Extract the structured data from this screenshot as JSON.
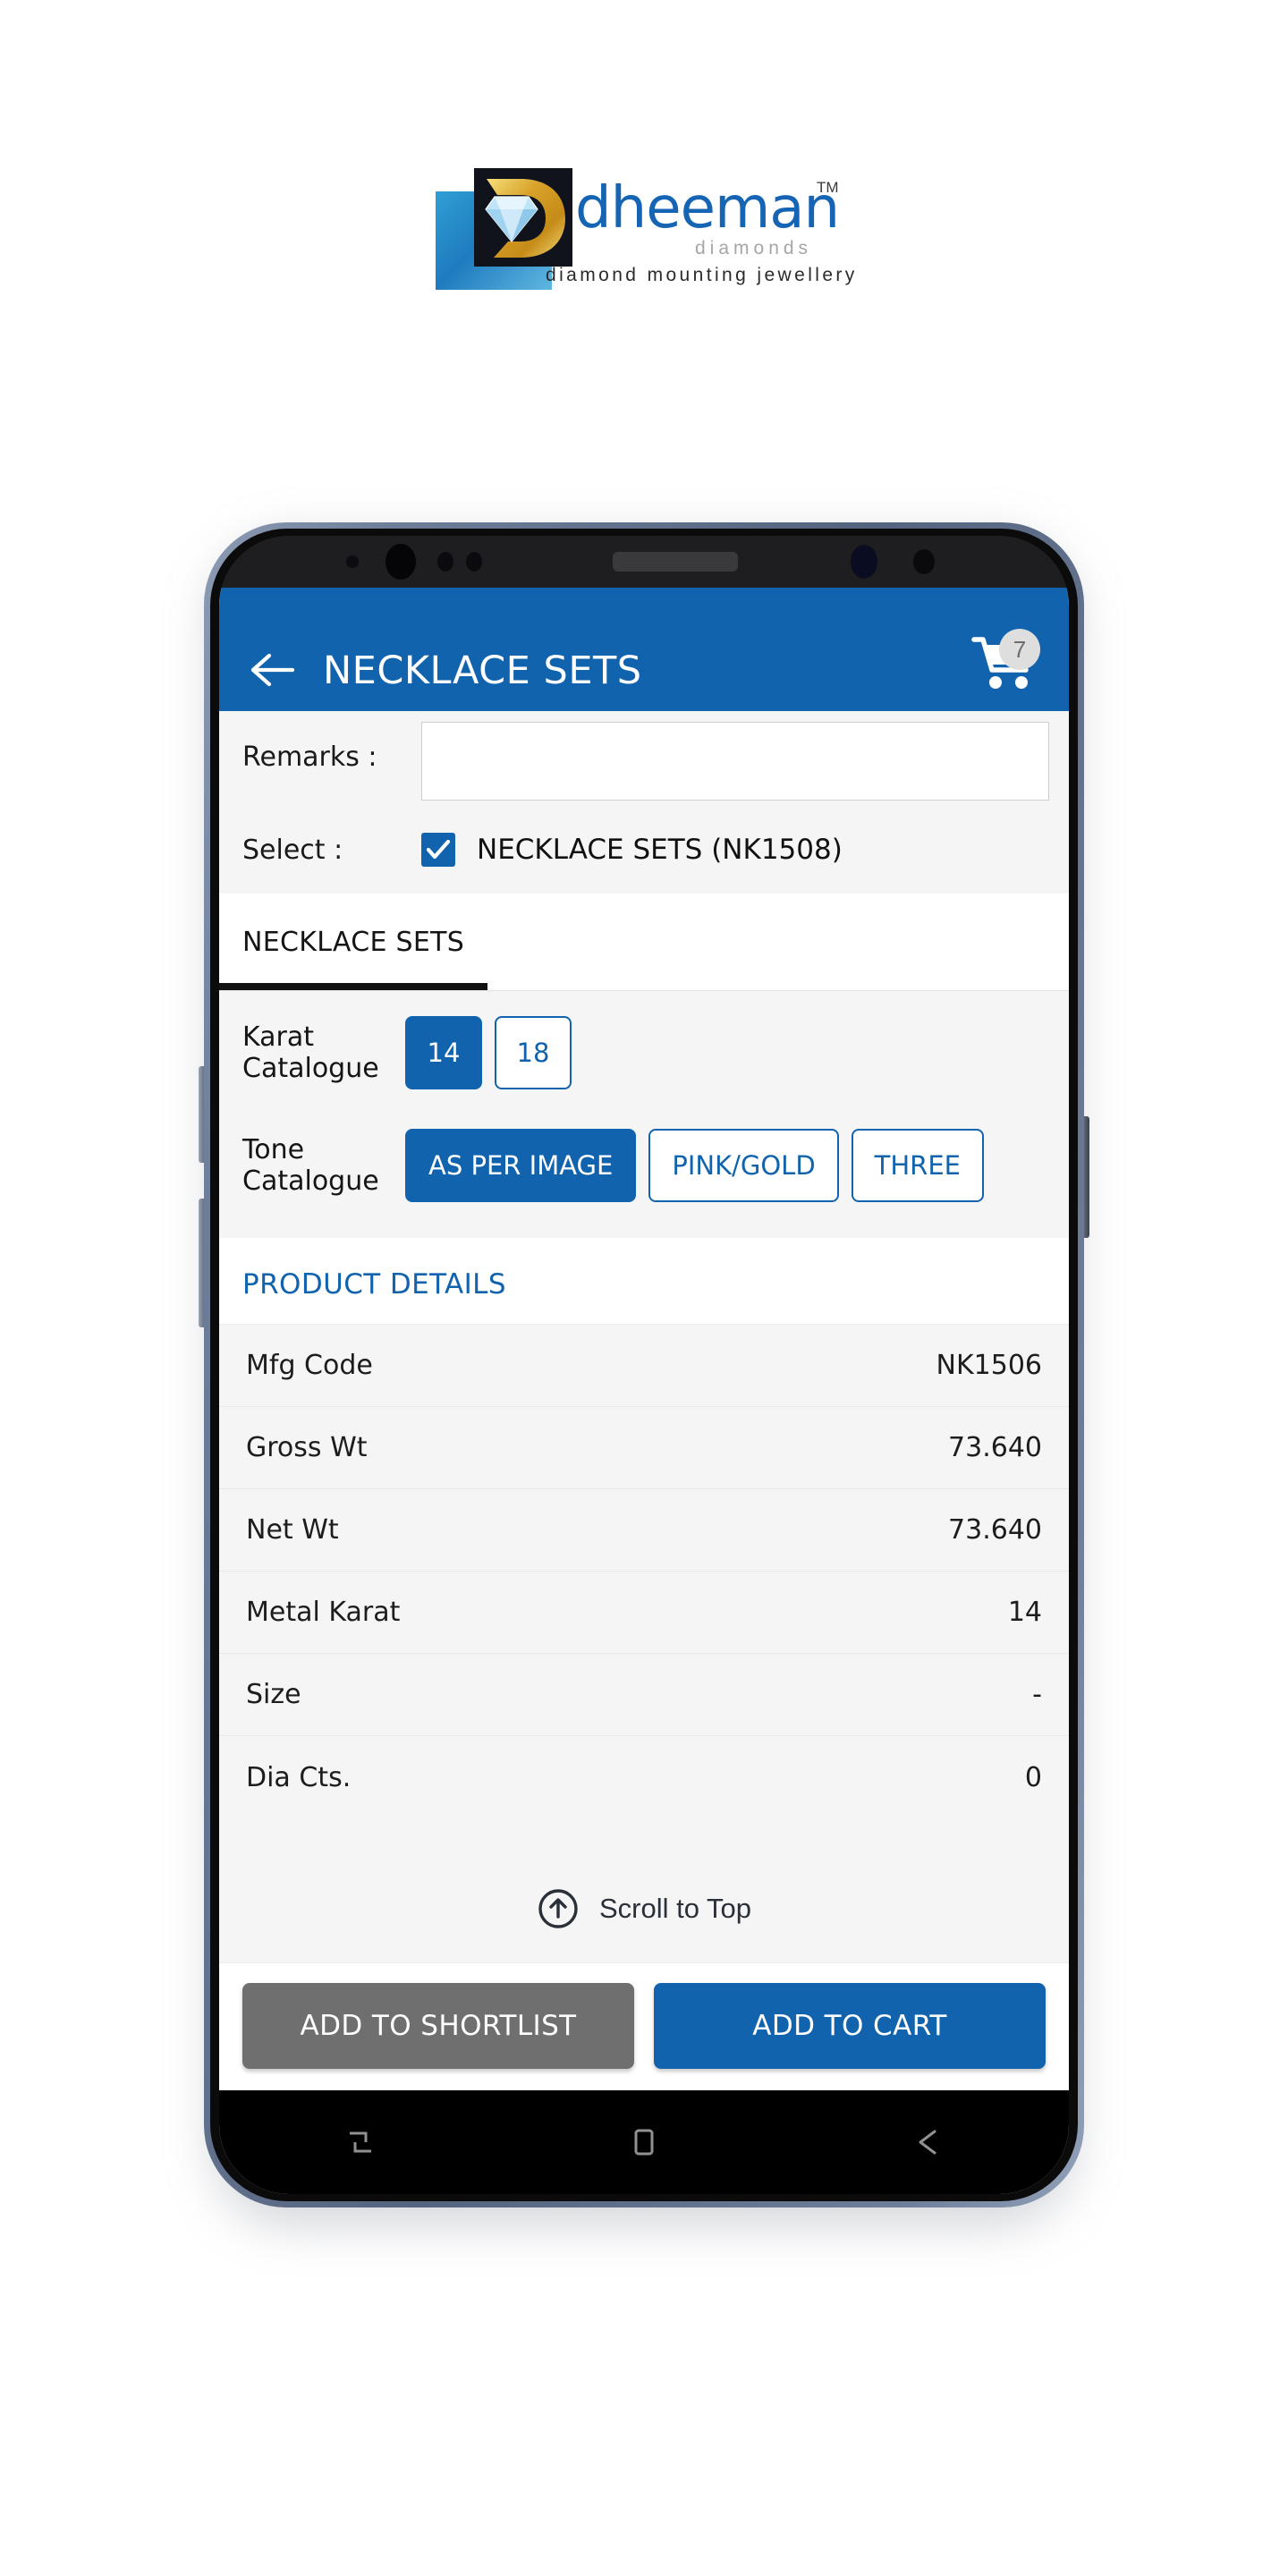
{
  "brand": {
    "name": "dheeman",
    "trademark": "TM",
    "sub1": "diamonds",
    "sub2": "diamond mounting jewellery"
  },
  "appbar": {
    "title": "NECKLACE SETS",
    "back_icon": "arrow-left-icon",
    "cart_icon": "shopping-cart-icon",
    "cart_count": "7"
  },
  "form": {
    "remarks_label": "Remarks :",
    "remarks_value": "",
    "remarks_placeholder": "",
    "select_label": "Select :",
    "select_item": "NECKLACE SETS (NK1508)",
    "select_checked": true
  },
  "tabs": [
    {
      "label": "NECKLACE SETS",
      "active": true
    }
  ],
  "catalogue": {
    "karat": {
      "label": "Karat Catalogue",
      "options": [
        {
          "label": "14",
          "selected": true
        },
        {
          "label": "18",
          "selected": false
        }
      ]
    },
    "tone": {
      "label": "Tone Catalogue",
      "options": [
        {
          "label": "AS PER IMAGE",
          "selected": true
        },
        {
          "label": "PINK/GOLD",
          "selected": false
        },
        {
          "label": "THREE",
          "selected": false
        }
      ]
    }
  },
  "product_details": {
    "header": "PRODUCT DETAILS",
    "rows": [
      {
        "key": "Mfg Code",
        "value": "NK1506"
      },
      {
        "key": "Gross Wt",
        "value": "73.640"
      },
      {
        "key": "Net Wt",
        "value": "73.640"
      },
      {
        "key": "Metal Karat",
        "value": "14"
      },
      {
        "key": "Size",
        "value": "-"
      },
      {
        "key": "Dia Cts.",
        "value": "0"
      }
    ]
  },
  "scroll_top": {
    "label": "Scroll to Top",
    "icon": "arrow-up-circle-icon"
  },
  "actions": {
    "shortlist_label": "ADD TO SHORTLIST",
    "cart_label": "ADD TO CART"
  },
  "navbar": {
    "recents_icon": "recents-icon",
    "home_icon": "home-square-icon",
    "back_icon": "arrow-left-icon"
  },
  "colors": {
    "primary_blue": "#1263ae",
    "shortlist_gray": "#6f6f6f",
    "screen_bg": "#f5f5f6",
    "tab_indicator": "#111111"
  }
}
